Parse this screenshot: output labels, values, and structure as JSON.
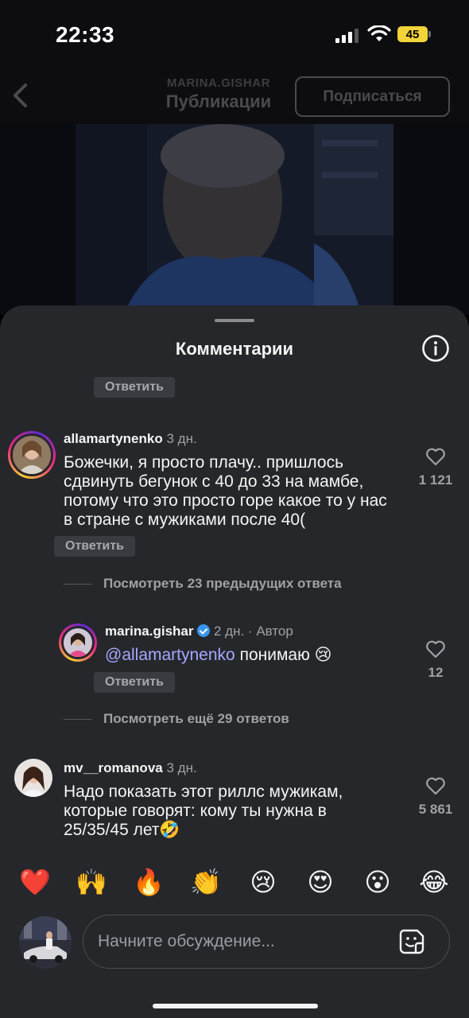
{
  "status_bar": {
    "time": "22:33",
    "battery": "45"
  },
  "nav": {
    "account": "MARINA.GISHAR",
    "title": "Публикации",
    "subscribe_label": "Подписаться"
  },
  "sheet": {
    "title": "Комментарии"
  },
  "reply_label": "Ответить",
  "comments": [
    {
      "username": "allamartynenko",
      "age": "3 дн.",
      "text": "Божечки, я просто плачу.. пришлось сдвинуть бегунок с 40 до 33 на мамбе, потому что это просто горе какое то у нас в стране с мужиками после 40(",
      "likes": "1 121"
    },
    {
      "username": "marina.gishar",
      "age": "2 дн.",
      "author_tag": "Автор",
      "mention": "@allamartynenko",
      "text": "понимаю 😢",
      "likes": "12"
    },
    {
      "username": "mv__romanova",
      "age": "3 дн.",
      "text": "Надо показать этот риллс мужикам, которые говорят: кому ты нужна в 25/35/45 лет🤣",
      "likes": "5 861"
    }
  ],
  "view_more": {
    "previous": "Посмотреть 23 предыдущих ответа",
    "more": "Посмотреть ещё 29 ответов"
  },
  "reactions": [
    "❤️",
    "🙌",
    "🔥",
    "👏",
    "😢",
    "😍",
    "😮",
    "😂"
  ],
  "composer": {
    "placeholder": "Начните обсуждение..."
  },
  "icons": {
    "back": "chevron-left-icon",
    "info": "info-icon",
    "heart": "heart-outline-icon",
    "sticker": "sticker-icon",
    "verified": "verified-badge-icon"
  },
  "colors": {
    "sheet_bg": "#26272b",
    "mention": "#a5a8ff",
    "verified": "#3797f0",
    "battery": "#f3d33a"
  }
}
